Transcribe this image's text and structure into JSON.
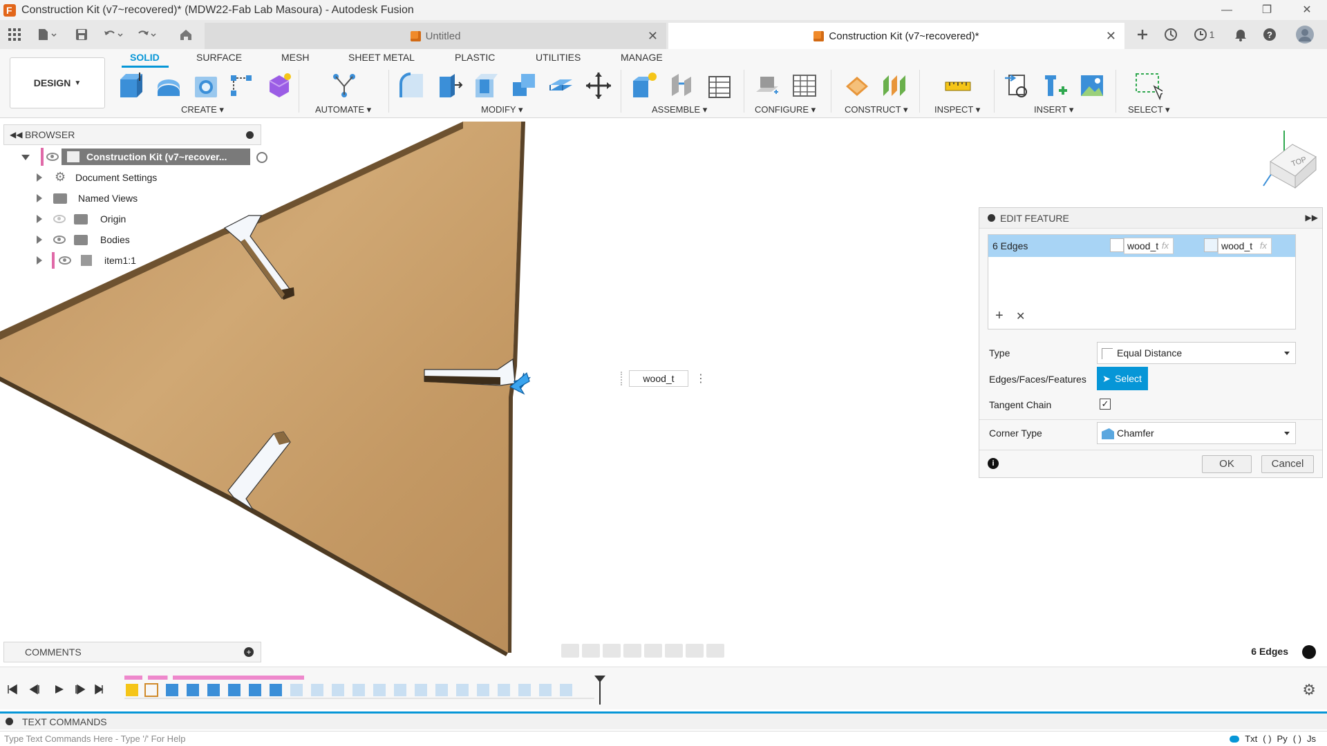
{
  "window": {
    "title": "Construction Kit (v7~recovered)* (MDW22-Fab Lab Masoura) - Autodesk Fusion"
  },
  "tabs": {
    "untitled": "Untitled",
    "active": "Construction Kit (v7~recovered)*",
    "job_count": "1"
  },
  "ribbon": {
    "workspace": "DESIGN",
    "tabs": [
      "SOLID",
      "SURFACE",
      "MESH",
      "SHEET METAL",
      "PLASTIC",
      "UTILITIES",
      "MANAGE"
    ],
    "groups": [
      "CREATE",
      "AUTOMATE",
      "MODIFY",
      "ASSEMBLE",
      "CONFIGURE",
      "CONSTRUCT",
      "INSPECT",
      "INSERT",
      "SELECT"
    ]
  },
  "browser": {
    "title": "BROWSER",
    "root": "Construction Kit (v7~recover...",
    "items": [
      "Document Settings",
      "Named Views",
      "Origin",
      "Bodies",
      "item1:1"
    ]
  },
  "viewcube": {
    "face": "TOP"
  },
  "viewport": {
    "param_input": "wood_t"
  },
  "edit_feature": {
    "title": "EDIT FEATURE",
    "row_label": "6 Edges",
    "param_1": "wood_t",
    "param_2": "wood_t",
    "fx": "fx",
    "type_label": "Type",
    "type_value": "Equal Distance",
    "edges_label": "Edges/Faces/Features",
    "select_label": "Select",
    "tangent_label": "Tangent Chain",
    "tangent_checked": true,
    "corner_label": "Corner Type",
    "corner_value": "Chamfer",
    "ok": "OK",
    "cancel": "Cancel"
  },
  "bottom": {
    "comments": "COMMENTS",
    "status": "6 Edges",
    "text_commands": "TEXT COMMANDS",
    "text_commands_placeholder": "Type Text Commands Here - Type '/' For Help",
    "txt": "Txt",
    "py": "Py",
    "js": "Js"
  },
  "colors": {
    "accent": "#0696d7",
    "wood": "#c9a06a",
    "wood_edge": "#5a4328",
    "selection": "#a8d4f5",
    "timeline_marker": "#ee88cc"
  }
}
